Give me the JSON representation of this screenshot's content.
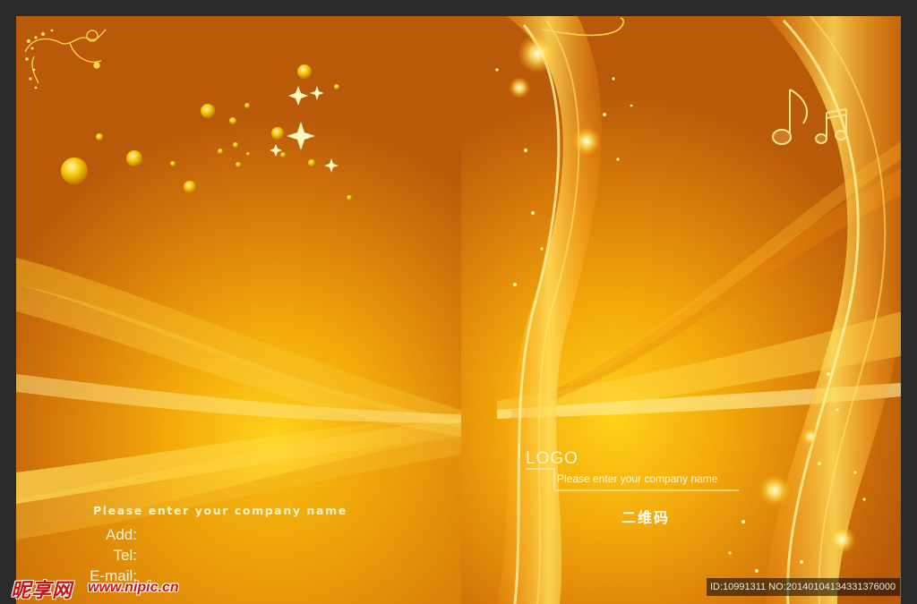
{
  "left_panel": {
    "company_name": "Please enter your company name",
    "add_label": "Add:",
    "tel_label": "Tel:",
    "email_label": "E-mail:"
  },
  "right_panel": {
    "logo": "LOGO",
    "company_name": "Please enter your company name",
    "qr_code_label": "二维码"
  },
  "watermark": {
    "site_logo": "昵享网",
    "site_url": "www.nipic.cn",
    "image_id": "ID:10991311 NO:20140104134331376000"
  },
  "colors": {
    "background": "#2a2a2a",
    "gold_bright": "#ffd21a",
    "orange_dark": "#b95a0a",
    "watermark_red": "#c91414"
  },
  "icons": [
    "flourish-icon",
    "sparkle-icon",
    "music-note-icon"
  ]
}
